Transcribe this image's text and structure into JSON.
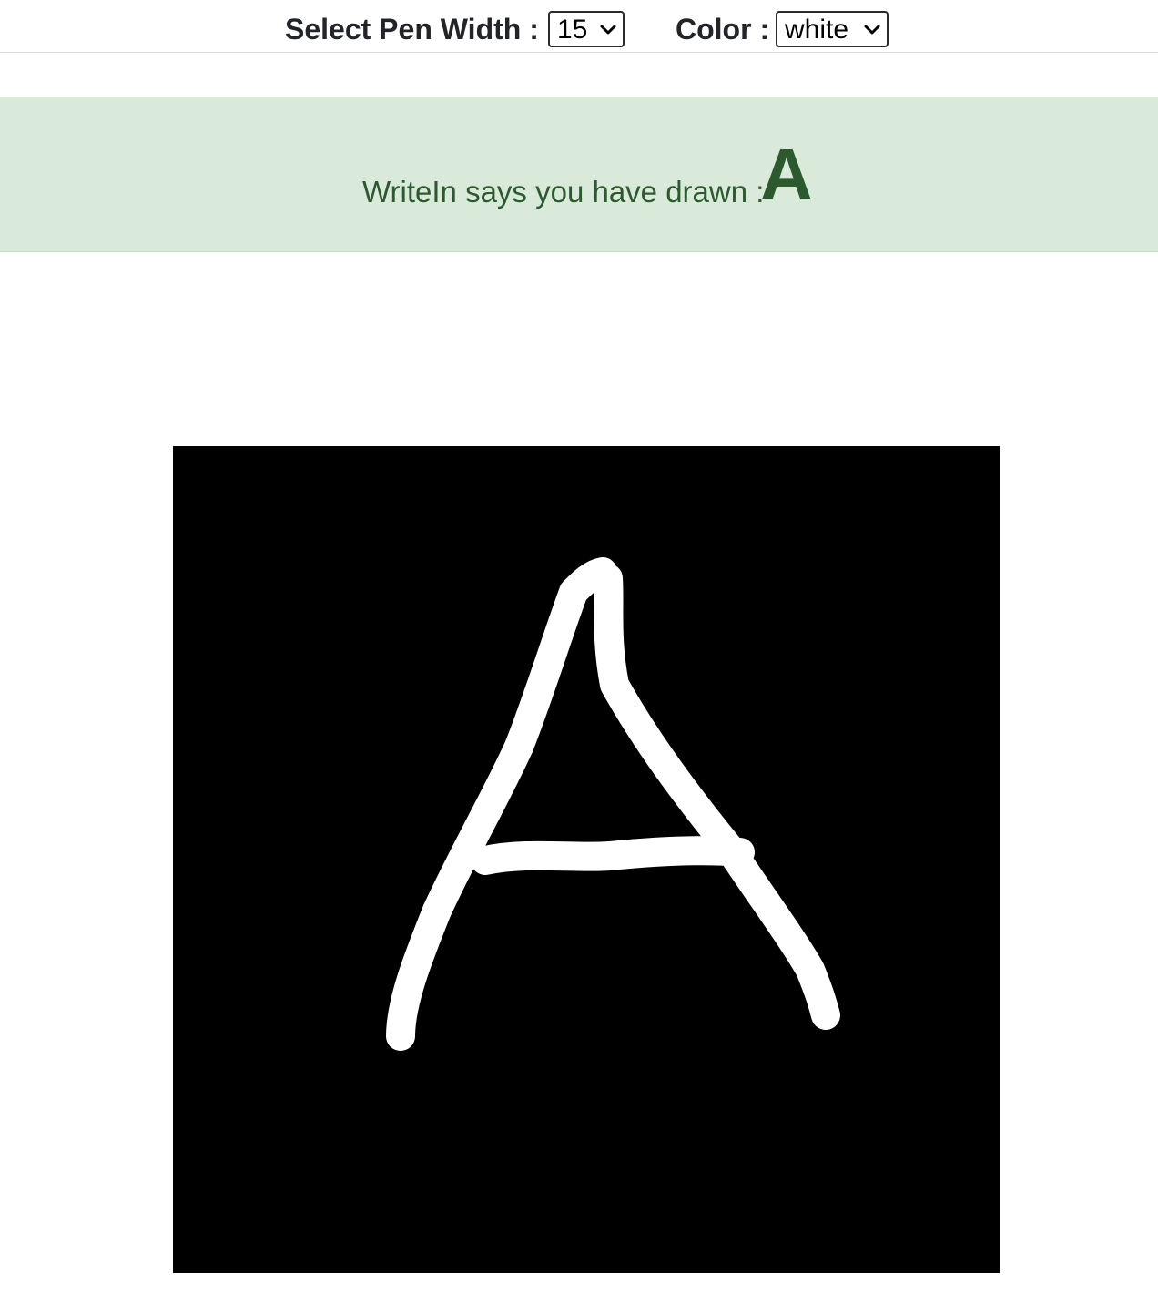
{
  "toolbar": {
    "pen_width_label": "Select Pen Width :",
    "pen_width_value": "15",
    "color_label": "Color :",
    "color_value": "white"
  },
  "result": {
    "message": "WriteIn says you have drawn :",
    "letter": "A"
  },
  "canvas": {
    "background_color": "#000000",
    "stroke_color": "#ffffff"
  },
  "colors": {
    "banner_background": "#d9eadb",
    "banner_text": "#2c5a2e"
  },
  "icons": {
    "dropdown": "chevron-down-icon"
  }
}
